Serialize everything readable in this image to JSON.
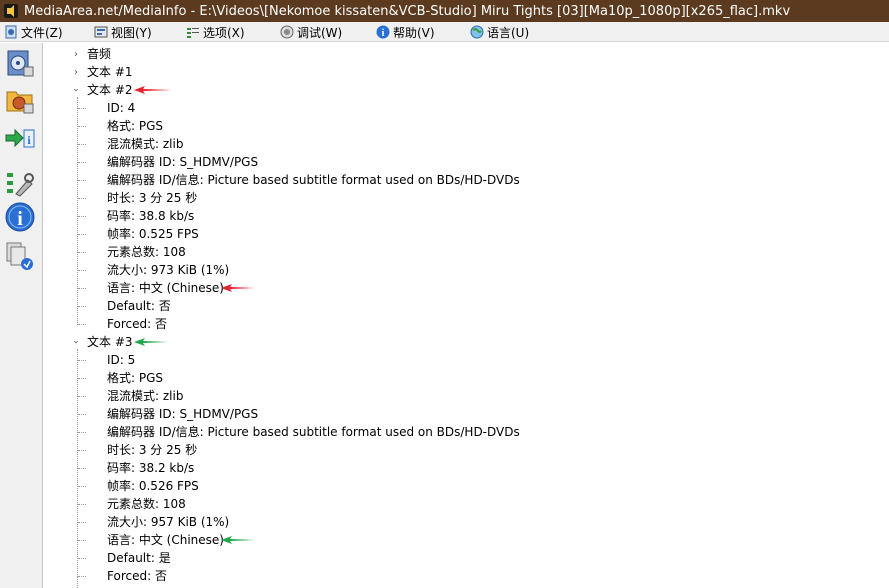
{
  "window": {
    "title": "MediaArea.net/MediaInfo - E:\\Videos\\[Nekomoe kissaten&VCB-Studio] Miru Tights [03][Ma10p_1080p][x265_flac].mkv"
  },
  "menu": {
    "file": "文件(Z)",
    "view": "视图(Y)",
    "options": "选项(X)",
    "debug": "调试(W)",
    "help": "帮助(V)",
    "language": "语言(U)"
  },
  "sidebar": {
    "icons": [
      "open-file-icon",
      "open-folder-icon",
      "export-icon",
      "preferences-icon",
      "about-icon",
      "newest-version-icon"
    ]
  },
  "tree": {
    "audio": "音频",
    "text1": "文本 #1",
    "text2": {
      "label": "文本 #2",
      "fields": [
        "ID: 4",
        "格式: PGS",
        "混流模式: zlib",
        "编解码器 ID: S_HDMV/PGS",
        "编解码器 ID/信息: Picture based subtitle format used on BDs/HD-DVDs",
        "时长: 3 分 25 秒",
        "码率: 38.8 kb/s",
        "帧率: 0.525 FPS",
        "元素总数: 108",
        "流大小: 973 KiB (1%)",
        "语言: 中文 (Chinese)",
        "Default: 否",
        "Forced: 否"
      ]
    },
    "text3": {
      "label": "文本 #3",
      "fields": [
        "ID: 5",
        "格式: PGS",
        "混流模式: zlib",
        "编解码器 ID: S_HDMV/PGS",
        "编解码器 ID/信息: Picture based subtitle format used on BDs/HD-DVDs",
        "时长: 3 分 25 秒",
        "码率: 38.2 kb/s",
        "帧率: 0.526 FPS",
        "元素总数: 108",
        "流大小: 957 KiB (1%)",
        "语言: 中文 (Chinese)",
        "Default: 是",
        "Forced: 否"
      ]
    }
  },
  "colors": {
    "red_arrow": "#e8202a",
    "green_arrow": "#1fa84a",
    "titlebar_bg": "#5b3a1f"
  }
}
